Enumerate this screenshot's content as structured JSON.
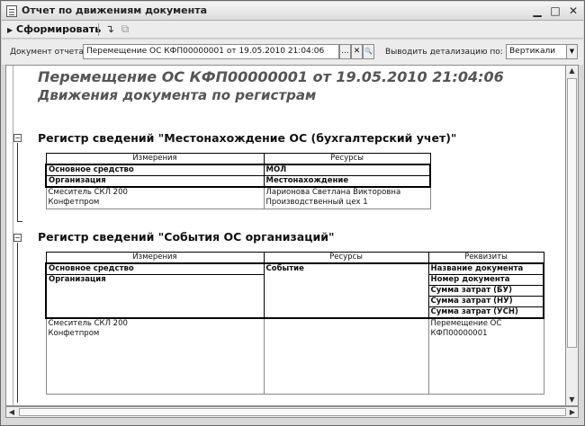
{
  "window": {
    "title": "Отчет по движениям документа",
    "minimize": "▁",
    "maximize": "□",
    "close": "✕"
  },
  "toolbar": {
    "generate_icon": "▶",
    "generate_label": "Сформировать",
    "settings_icon": "↴",
    "copy_icon": "⧉"
  },
  "params": {
    "doc_label": "Документ отчета:",
    "doc_value": "Перемещение ОС КФП00000001 от 19.05.2010 21:04:06",
    "select_btn": "...",
    "clear_btn": "✕",
    "open_btn": "🔍",
    "detail_label": "Выводить детализацию по:",
    "detail_value": "Вертикали",
    "detail_dropdown": "▼"
  },
  "report": {
    "heading": "Перемещение ОС КФП00000001 от 19.05.2010 21:04:06",
    "subheading": "Движения документа по регистрам",
    "group_icon": "−",
    "register1": {
      "title": "Регистр сведений \"Местонахождение ОС (бухгалтерский учет)\"",
      "col_dims": "Измерения",
      "col_res": "Ресурсы",
      "dim1": "Основное средство",
      "dim2": "Организация",
      "res1": "МОЛ",
      "res2": "Местонахождение",
      "row": {
        "dim1": "Смеситель СКЛ 200",
        "dim2": "Конфетпром",
        "res1": "Ларионова Светлана Викторовна",
        "res2": "Производственный цех 1"
      }
    },
    "register2": {
      "title": "Регистр сведений \"События ОС организаций\"",
      "col_dims": "Измерения",
      "col_res": "Ресурсы",
      "col_req": "Реквизиты",
      "dim1": "Основное средство",
      "dim2": "Организация",
      "res1": "Событие",
      "req1": "Название документа",
      "req2": "Номер документа",
      "req3": "Сумма затрат (БУ)",
      "req4": "Сумма затрат (НУ)",
      "req5": "Сумма затрат (УСН)",
      "row": {
        "dim1": "Смеситель СКЛ 200",
        "dim2": "Конфетпром",
        "req1": "Перемещение ОС",
        "req2": "КФП00000001"
      }
    }
  },
  "scroll": {
    "up": "▲",
    "down": "▼",
    "left": "◀",
    "right": "▶"
  }
}
